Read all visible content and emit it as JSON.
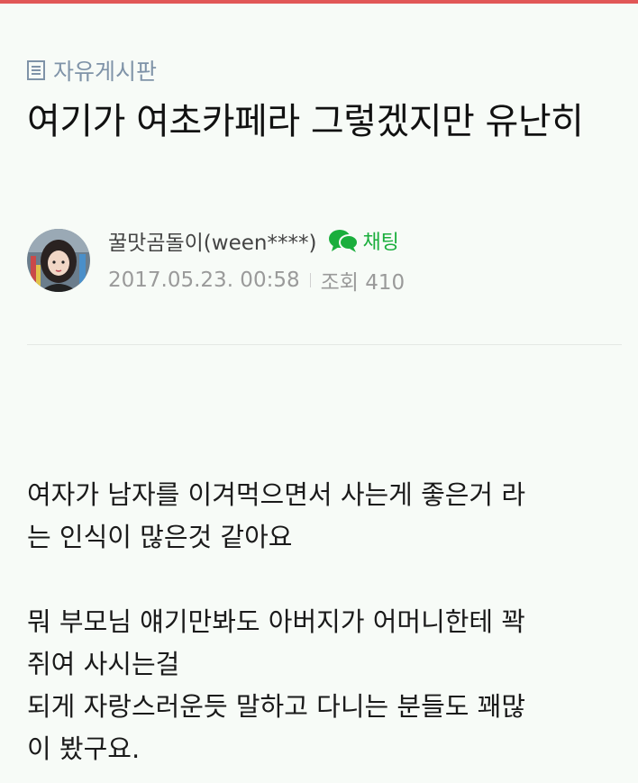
{
  "board": {
    "icon": "list-board-icon",
    "name": "자유게시판"
  },
  "post": {
    "title": "여기가 여초카페라 그렇겠지만 유난히",
    "author": "꿀맛곰돌이(ween****)",
    "chat_label": "채팅",
    "date": "2017.05.23. 00:58",
    "views": "조회 410",
    "paragraphs": [
      [
        "여자가 남자를 이겨먹으면서 사는게 좋은거 라",
        "는 인식이 많은것 같아요"
      ],
      [
        "뭐 부모님 얘기만봐도 아버지가 어머니한테 꽉",
        "쥐여 사시는걸",
        "되게 자랑스러운듯 말하고 다니는 분들도 꽤많",
        "이 봤구요."
      ]
    ]
  },
  "colors": {
    "accent_bar": "#e15757",
    "board_link": "#7f93a8",
    "chat_green": "#1aae3c",
    "meta_gray": "#9a9a9a"
  }
}
